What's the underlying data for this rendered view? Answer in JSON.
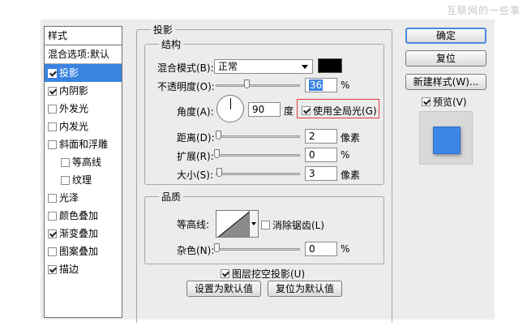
{
  "watermark": "互联网的一些事",
  "sidebar": {
    "header": "样式",
    "items": [
      {
        "label": "混合选项:默认",
        "checkbox": false
      },
      {
        "label": "投影",
        "checkbox": true,
        "checked": true,
        "selected": true
      },
      {
        "label": "内阴影",
        "checkbox": true,
        "checked": true
      },
      {
        "label": "外发光",
        "checkbox": true,
        "checked": false
      },
      {
        "label": "内发光",
        "checkbox": true,
        "checked": false
      },
      {
        "label": "斜面和浮雕",
        "checkbox": true,
        "checked": false
      },
      {
        "label": "等高线",
        "checkbox": true,
        "checked": false,
        "indent": true
      },
      {
        "label": "纹理",
        "checkbox": true,
        "checked": false,
        "indent": true
      },
      {
        "label": "光泽",
        "checkbox": true,
        "checked": false
      },
      {
        "label": "颜色叠加",
        "checkbox": true,
        "checked": false
      },
      {
        "label": "渐变叠加",
        "checkbox": true,
        "checked": true
      },
      {
        "label": "图案叠加",
        "checkbox": true,
        "checked": false
      },
      {
        "label": "描边",
        "checkbox": true,
        "checked": true
      }
    ]
  },
  "shadow": {
    "title": "投影",
    "structure": {
      "title": "结构",
      "blend_mode_label": "混合模式(B):",
      "blend_mode_value": "正常",
      "blend_color": "#000000",
      "opacity_label": "不透明度(O):",
      "opacity_value": "36",
      "opacity_unit": "%",
      "angle_label": "角度(A):",
      "angle_value": "90",
      "angle_unit": "度",
      "global_light_label": "使用全局光(G)",
      "global_light_checked": true,
      "distance_label": "距离(D):",
      "distance_value": "2",
      "distance_unit": "像素",
      "spread_label": "扩展(R):",
      "spread_value": "0",
      "spread_unit": "%",
      "size_label": "大小(S):",
      "size_value": "3",
      "size_unit": "像素"
    },
    "quality": {
      "title": "品质",
      "contour_label": "等高线:",
      "antialias_label": "消除锯齿(L)",
      "antialias_checked": false,
      "noise_label": "杂色(N):",
      "noise_value": "0",
      "noise_unit": "%"
    },
    "knockout_label": "图层挖空投影(U)",
    "knockout_checked": true,
    "set_default_label": "设置为默认值",
    "reset_default_label": "复位为默认值"
  },
  "actions": {
    "ok_label": "确定",
    "reset_label": "复位",
    "new_style_label": "新建样式(W)...",
    "preview_label": "预览(V)",
    "preview_checked": true,
    "preview_color": "#3d86e6"
  }
}
